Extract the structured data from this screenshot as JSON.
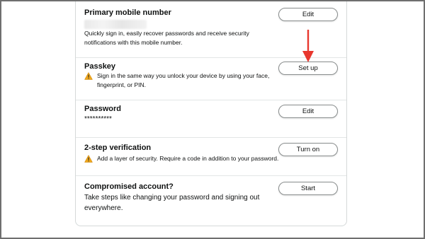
{
  "rows": [
    {
      "title": "Primary mobile number",
      "description": "Quickly sign in, easily recover passwords and receive security notifications with this mobile number.",
      "button": "Edit"
    },
    {
      "title": "Passkey",
      "description": "Sign in the same way you unlock your device by using your face, fingerprint, or PIN.",
      "button": "Set up"
    },
    {
      "title": "Password",
      "value": "**********",
      "button": "Edit"
    },
    {
      "title": "2-step verification",
      "description": "Add a layer of security. Require a code in addition to your password.",
      "button": "Turn on"
    },
    {
      "title": "Compromised account?",
      "description": "Take steps like changing your password and signing out everywhere.",
      "button": "Start"
    }
  ],
  "icons": {
    "warning": "warning-icon",
    "annotation": "down-arrow-annotation"
  },
  "colors": {
    "warning_fill": "#f0a81c",
    "annotation_red": "#e8372e",
    "button_border": "#888c8c"
  }
}
